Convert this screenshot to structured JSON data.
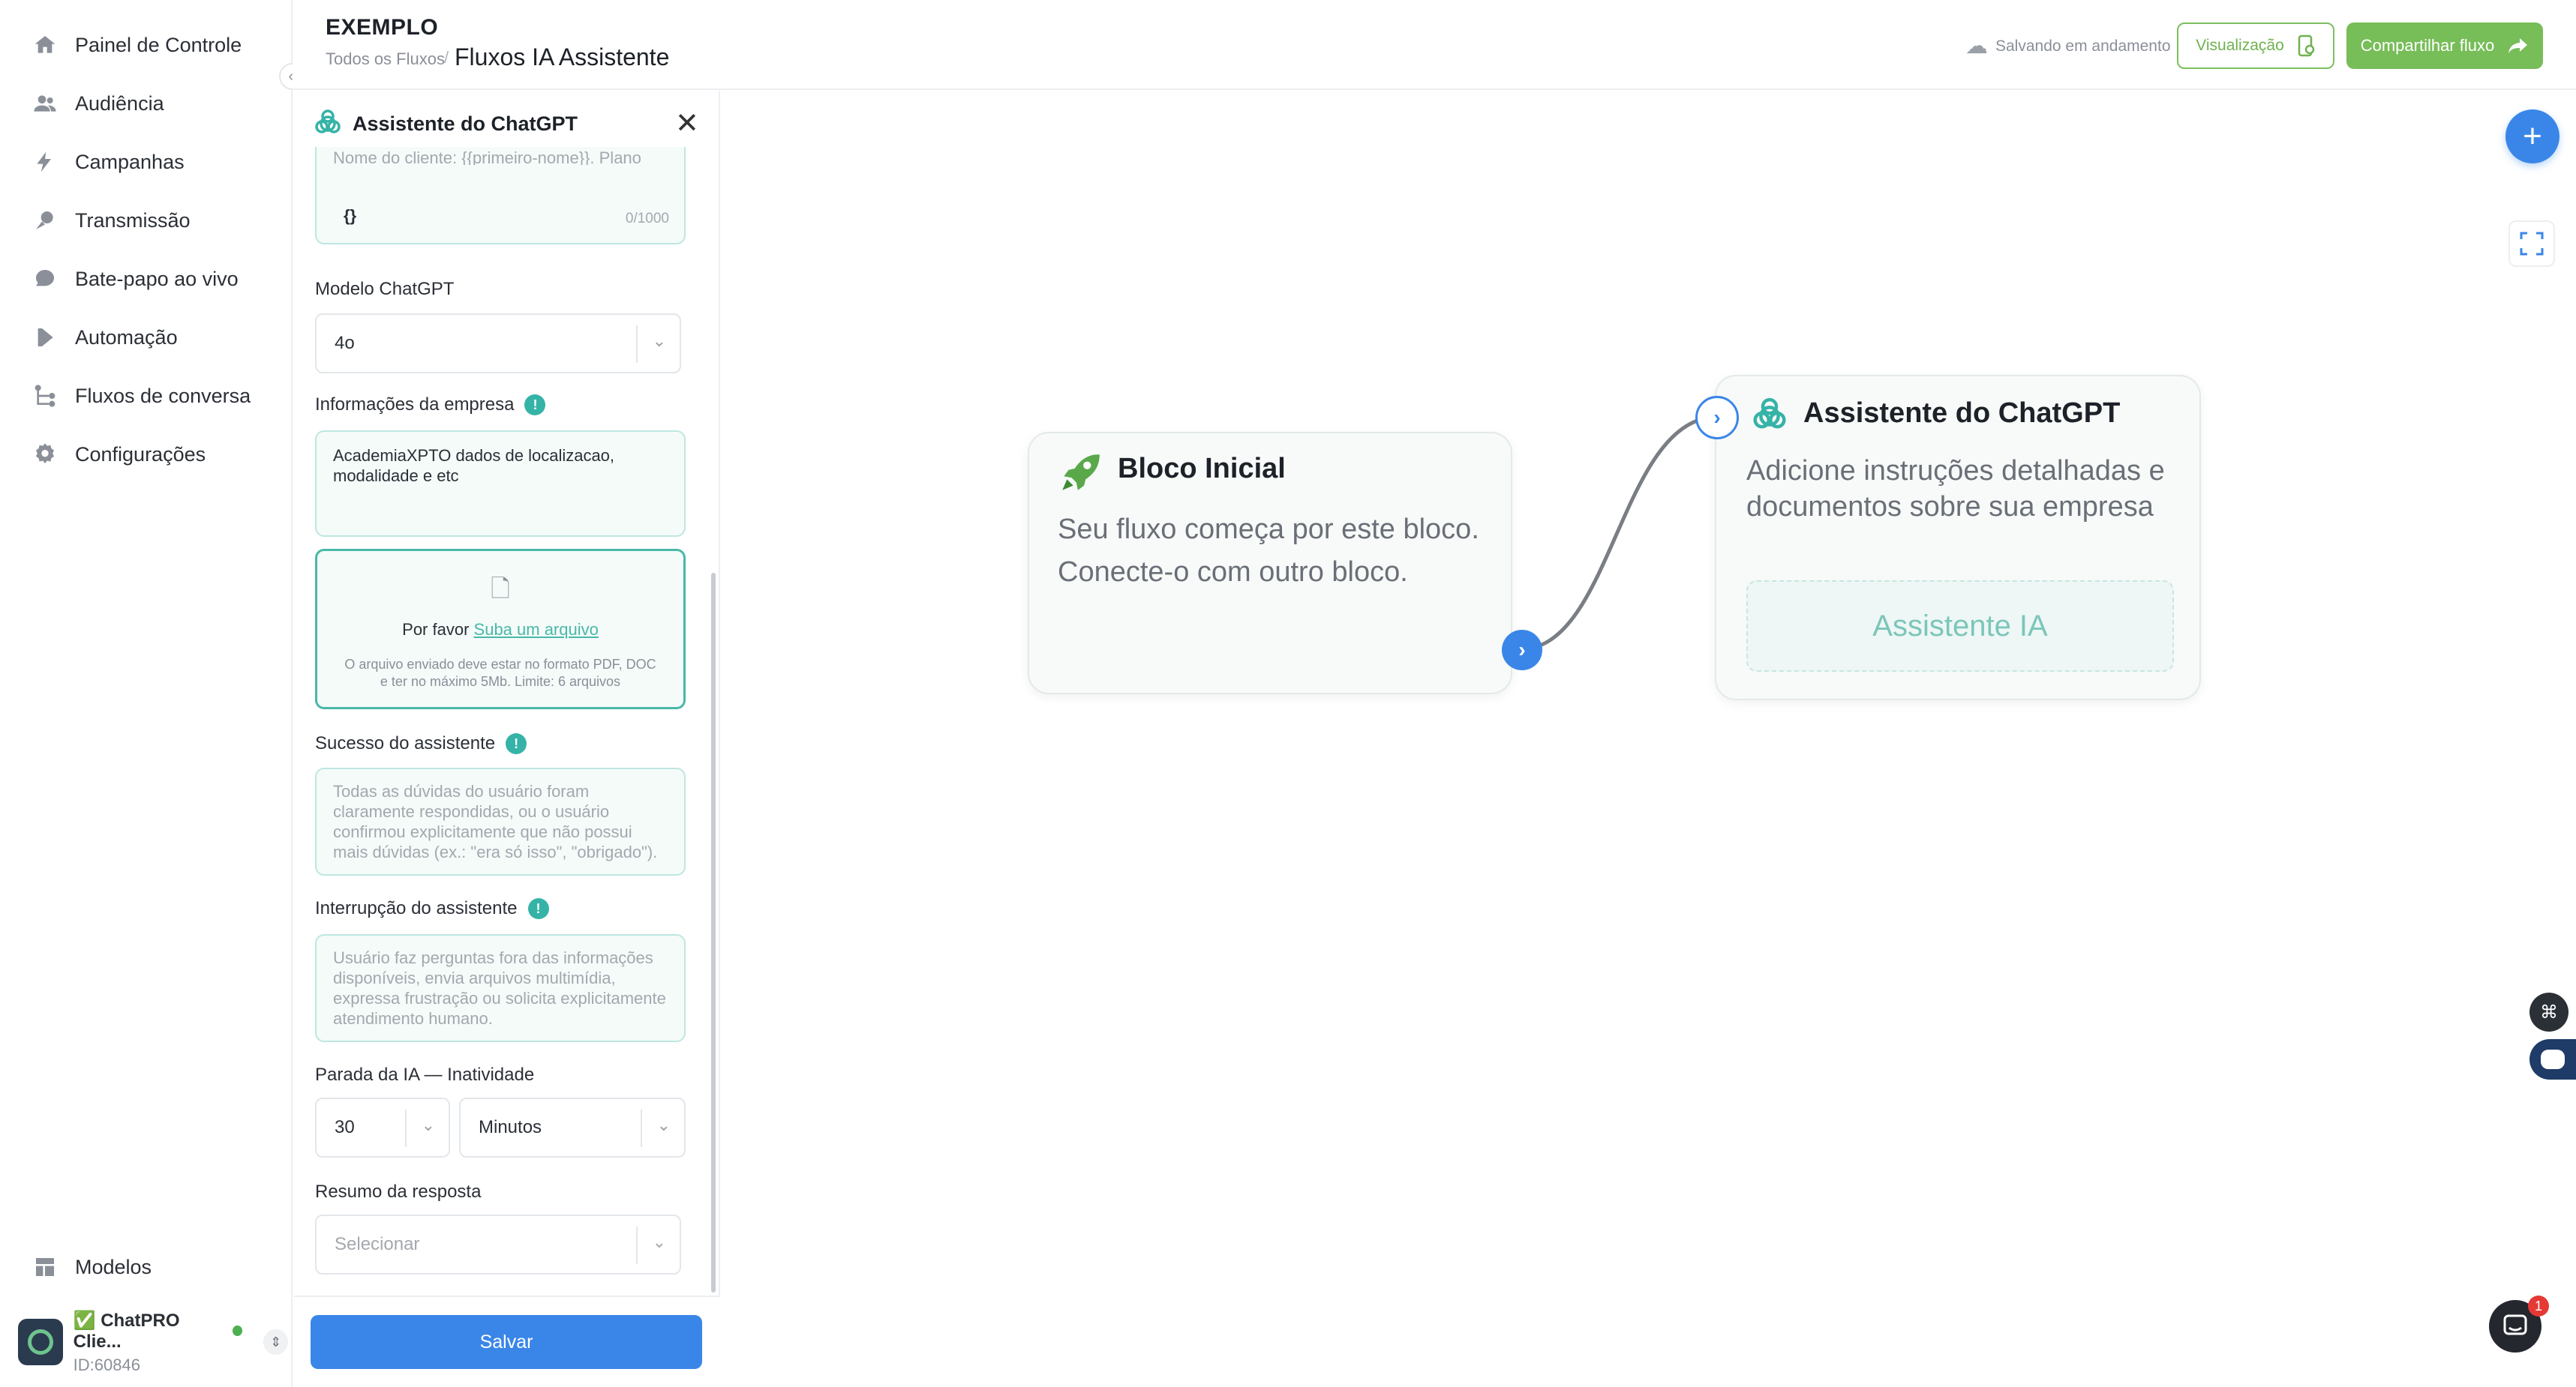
{
  "sidebar": {
    "items": [
      {
        "label": "Painel de Controle",
        "icon": "home-icon"
      },
      {
        "label": "Audiência",
        "icon": "users-icon"
      },
      {
        "label": "Campanhas",
        "icon": "bolt-icon"
      },
      {
        "label": "Transmissão",
        "icon": "broadcast-icon"
      },
      {
        "label": "Bate-papo ao vivo",
        "icon": "chat-bubble-icon"
      },
      {
        "label": "Automação",
        "icon": "play-icon"
      },
      {
        "label": "Fluxos de conversa",
        "icon": "flow-icon"
      },
      {
        "label": "Configurações",
        "icon": "gear-icon"
      }
    ],
    "bottom_item": {
      "label": "Modelos",
      "icon": "templates-icon"
    },
    "account": {
      "name": "✅ ChatPRO Clie...",
      "id": "ID:60846"
    }
  },
  "header": {
    "brand": "EXEMPLO",
    "breadcrumb_root": "Todos os Fluxos",
    "breadcrumb_sep": "/",
    "title": "Fluxos IA Assistente",
    "saving_status": "Salvando em andamento",
    "preview_label": "Visualização",
    "share_label": "Compartilhar fluxo"
  },
  "panel": {
    "title": "Assistente do ChatGPT",
    "prompt_field": {
      "placeholder_partial": "Nome do cliente: {{primeiro-nome}}. Plano",
      "braces": "{}",
      "counter": "0/1000"
    },
    "model": {
      "label": "Modelo ChatGPT",
      "value": "4o"
    },
    "company_info": {
      "label": "Informações da empresa",
      "value": "AcademiaXPTO dados de localizacao, modalidade e etc"
    },
    "upload": {
      "prefix": "Por favor",
      "link": "Suba um arquivo",
      "hint": "O arquivo enviado deve estar no formato PDF, DOC e ter no máximo 5Mb. Limite: 6 arquivos"
    },
    "success": {
      "label": "Sucesso do assistente",
      "placeholder": "Todas as dúvidas do usuário foram claramente respondidas, ou o usuário confirmou explicitamente que não possui mais dúvidas (ex.: \"era só isso\", \"obrigado\")."
    },
    "interrupt": {
      "label": "Interrupção do assistente",
      "placeholder": "Usuário faz perguntas fora das informações disponíveis, envia arquivos multimídia, expressa frustração ou solicita explicitamente atendimento humano."
    },
    "inactivity": {
      "label": "Parada da IA — Inatividade",
      "amount": "30",
      "unit": "Minutos"
    },
    "summary": {
      "label": "Resumo da resposta",
      "placeholder": "Selecionar"
    },
    "save_label": "Salvar"
  },
  "canvas": {
    "start_node": {
      "title": "Bloco Inicial",
      "description": "Seu fluxo começa por este bloco. Conecte-o com outro bloco."
    },
    "ai_node": {
      "title": "Assistente do ChatGPT",
      "description": "Adicione instruções detalhadas e documentos sobre sua empresa",
      "slot_label": "Assistente IA"
    },
    "chat_badge": "1"
  },
  "colors": {
    "accent_blue": "#3a86e8",
    "accent_green": "#77bd58",
    "teal": "#49b8a8"
  }
}
